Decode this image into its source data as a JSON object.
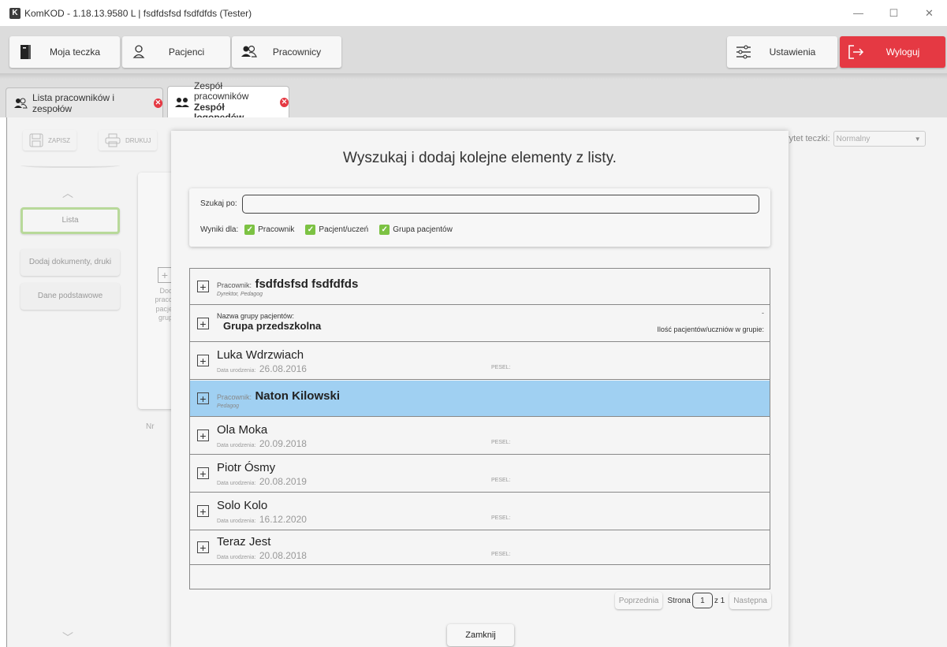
{
  "window": {
    "logo_letter": "K",
    "title": "KomKOD - 1.18.13.9580 L | fsdfdsfsd fsdfdfds (Tester)",
    "minimize": "—",
    "maximize": "☐",
    "close": "✕"
  },
  "toolbar": {
    "my_folder": "Moja teczka",
    "patients": "Pacjenci",
    "employees": "Pracownicy",
    "settings": "Ustawienia",
    "logout": "Wyloguj"
  },
  "tabs": [
    {
      "label": "Lista pracowników i zespołów"
    },
    {
      "label_line1": "Zespół pracowników",
      "label_line2": "Zespół logopedów"
    }
  ],
  "background": {
    "save": "ZAPISZ",
    "print": "DRUKUJ",
    "sidebar": [
      "Lista",
      "Dodaj dokumenty, druki",
      "Dane podstawowe"
    ],
    "card_text": "Dod praco pacje grup",
    "nr_header": "Nr",
    "priority_label": "rytet teczki:",
    "priority_value": "Normalny"
  },
  "modal": {
    "title": "Wyszukaj i dodaj kolejne elementy z listy.",
    "search_label": "Szukaj po:",
    "search_value": "",
    "results_for": "Wyniki dla:",
    "filters": [
      {
        "label": "Pracownik",
        "checked": true
      },
      {
        "label": "Pacjent/uczeń",
        "checked": true
      },
      {
        "label": "Grupa pacjentów",
        "checked": true
      }
    ],
    "results": [
      {
        "type": "employee",
        "prefix": "Pracownik:",
        "name": "fsdfdsfsd fsdfdfds",
        "roles": "Dyrektor, Pedagog"
      },
      {
        "type": "group",
        "prefix": "Nazwa grupy pacjentów:",
        "name": "Grupa przedszkolna",
        "count_label": "Ilość pacjentów/uczniów w grupie:",
        "count_value": "-"
      },
      {
        "type": "patient",
        "name": "Luka Wdrzwiach",
        "dob_label": "Data urodzenia:",
        "dob": "26.08.2016",
        "pesel_label": "PESEL:"
      },
      {
        "type": "employee",
        "prefix": "Pracownik:",
        "name": "Naton Kilowski",
        "roles": "Pedagog"
      },
      {
        "type": "patient",
        "name": "Ola Moka",
        "dob_label": "Data urodzenia:",
        "dob": "20.09.2018",
        "pesel_label": "PESEL:"
      },
      {
        "type": "patient",
        "name": "Piotr Ósmy",
        "dob_label": "Data urodzenia:",
        "dob": "20.08.2019",
        "pesel_label": "PESEL:"
      },
      {
        "type": "patient",
        "name": "Solo Kolo",
        "dob_label": "Data urodzenia:",
        "dob": "16.12.2020",
        "pesel_label": "PESEL:"
      },
      {
        "type": "patient",
        "name": "Teraz Jest",
        "dob_label": "Data urodzenia:",
        "dob": "20.08.2018",
        "pesel_label": "PESEL:"
      }
    ],
    "pager": {
      "prev": "Poprzednia",
      "page_label": "Strona",
      "page": "1",
      "of": "z 1",
      "next": "Następna"
    },
    "close": "Zamknij"
  },
  "colors": {
    "logout": "#e53943",
    "highlight_row": "#a0d0f2",
    "checkbox": "#7cc243",
    "selected_sidebar_border": "#b8d99a"
  }
}
